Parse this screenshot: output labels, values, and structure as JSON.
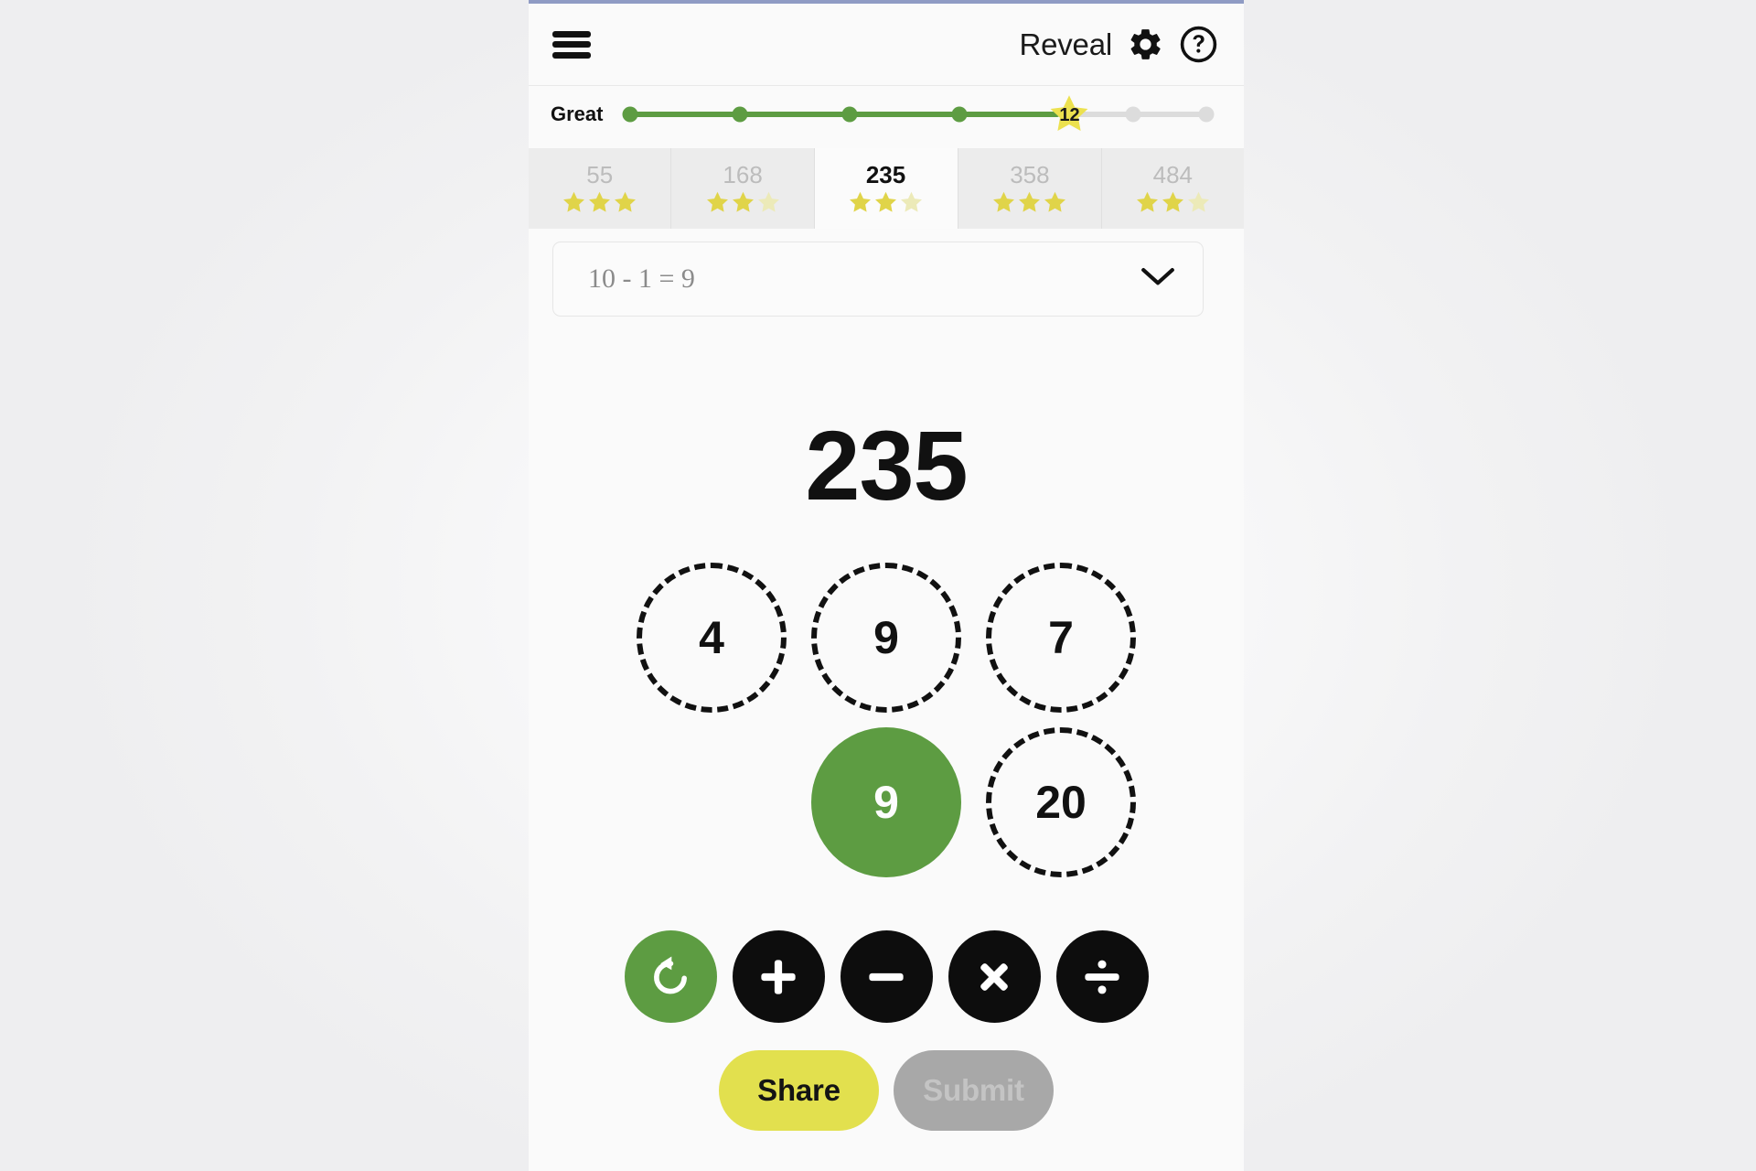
{
  "app": {
    "accent_color": "#8f9bc4",
    "panel_bg": "#fafafa",
    "page_bg": "#f4f4f5"
  },
  "header": {
    "menu_icon": "hamburger-menu-icon",
    "reveal_label": "Reveal",
    "settings_icon": "gear-icon",
    "help_icon": "question-mark-circle-icon"
  },
  "progress": {
    "label": "Great",
    "completed_nodes": 4,
    "remaining_nodes": 2,
    "star_value": "12",
    "done_color": "#5d9c42",
    "todo_color": "#dcdcdc",
    "star_color": "#ece14f"
  },
  "level_tabs": [
    {
      "number": "55",
      "stars_filled": 3,
      "stars_total": 3,
      "active": false
    },
    {
      "number": "168",
      "stars_filled": 2,
      "stars_total": 3,
      "active": false
    },
    {
      "number": "235",
      "stars_filled": 2,
      "stars_total": 3,
      "active": true
    },
    {
      "number": "358",
      "stars_filled": 3,
      "stars_total": 3,
      "active": false
    },
    {
      "number": "484",
      "stars_filled": 2,
      "stars_total": 3,
      "active": false
    }
  ],
  "equation_select": {
    "value": "10 - 1 = 9",
    "chevron_icon": "chevron-down-icon"
  },
  "target_number": "235",
  "number_tiles": [
    {
      "value": "4",
      "state": "available"
    },
    {
      "value": "9",
      "state": "available"
    },
    {
      "value": "7",
      "state": "available"
    },
    {
      "value": "9",
      "state": "selected"
    },
    {
      "value": "20",
      "state": "available"
    }
  ],
  "operators": [
    {
      "name": "undo",
      "glyph": "undo-icon",
      "style": "green"
    },
    {
      "name": "plus",
      "glyph": "plus-icon",
      "style": "black"
    },
    {
      "name": "minus",
      "glyph": "minus-icon",
      "style": "black"
    },
    {
      "name": "multiply",
      "glyph": "multiply-icon",
      "style": "black"
    },
    {
      "name": "divide",
      "glyph": "divide-icon",
      "style": "black"
    }
  ],
  "actions": {
    "share_label": "Share",
    "share_color": "#e2e04e",
    "submit_label": "Submit",
    "submit_color": "#a8a8a8",
    "submit_enabled": false
  }
}
